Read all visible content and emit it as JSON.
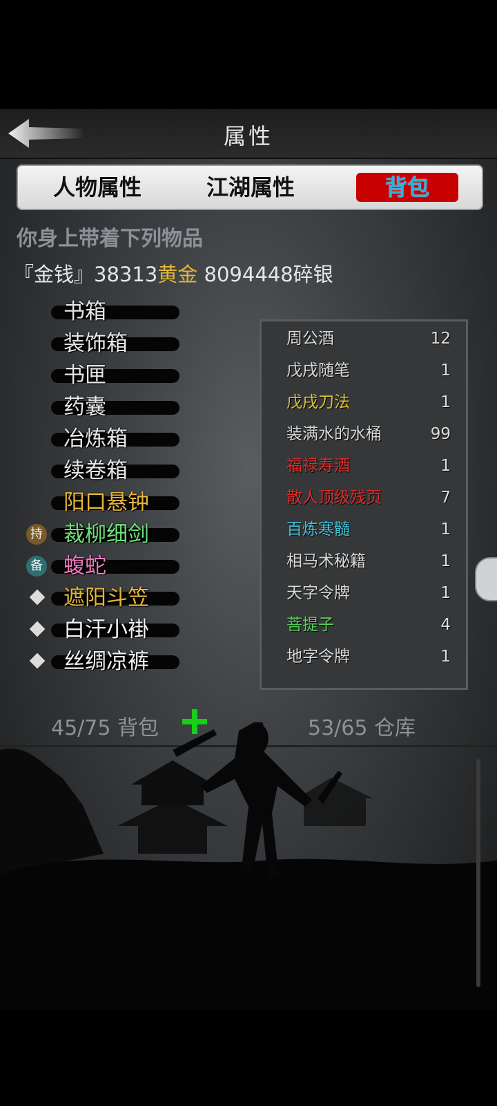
{
  "header": {
    "title": "属性"
  },
  "tabs": [
    {
      "label": "人物属性",
      "active": false
    },
    {
      "label": "江湖属性",
      "active": false
    },
    {
      "label": "背包",
      "active": true
    }
  ],
  "note": "你身上带着下列物品",
  "money": {
    "prefix": "『金钱』",
    "gold_amount": "38313",
    "gold_label": "黄金",
    "silver_amount": "8094448",
    "silver_label": "碎银"
  },
  "left_items": [
    {
      "label": "书箱",
      "color": "#e6e6e6",
      "marker": ""
    },
    {
      "label": "装饰箱",
      "color": "#e6e6e6",
      "marker": ""
    },
    {
      "label": "书匣",
      "color": "#e6e6e6",
      "marker": ""
    },
    {
      "label": "药囊",
      "color": "#e6e6e6",
      "marker": ""
    },
    {
      "label": "冶炼箱",
      "color": "#e6e6e6",
      "marker": ""
    },
    {
      "label": "续卷箱",
      "color": "#e6e6e6",
      "marker": ""
    },
    {
      "label": "阳口悬钟",
      "color": "#e3b53a",
      "marker": ""
    },
    {
      "label": "裁柳细剑",
      "color": "#6ee07a",
      "marker": "持"
    },
    {
      "label": "蝮蛇",
      "color": "#f07bc0",
      "marker": "备"
    },
    {
      "label": "遮阳斗笠",
      "color": "#e3b53a",
      "marker": "diamond"
    },
    {
      "label": "白汗小褂",
      "color": "#f2f2f2",
      "marker": "diamond"
    },
    {
      "label": "丝绸凉裤",
      "color": "#f2f2f2",
      "marker": "diamond"
    }
  ],
  "right_items": [
    {
      "name": "周公酒",
      "qty": "12",
      "color": "#d8d8d8"
    },
    {
      "name": "戊戌随笔",
      "qty": "1",
      "color": "#d8d8d8"
    },
    {
      "name": "戊戌刀法",
      "qty": "1",
      "color": "#d8c23a"
    },
    {
      "name": "装满水的水桶",
      "qty": "99",
      "color": "#d8d8d8"
    },
    {
      "name": "福禄寿酒",
      "qty": "1",
      "color": "#e02a2a"
    },
    {
      "name": "散人顶级残页",
      "qty": "7",
      "color": "#e02a2a"
    },
    {
      "name": "百炼寒髓",
      "qty": "1",
      "color": "#45c2d8"
    },
    {
      "name": "相马术秘籍",
      "qty": "1",
      "color": "#d8d8d8"
    },
    {
      "name": "天字令牌",
      "qty": "1",
      "color": "#d8d8d8"
    },
    {
      "name": "菩提子",
      "qty": "4",
      "color": "#5ccf5c"
    },
    {
      "name": "地字令牌",
      "qty": "1",
      "color": "#d8d8d8"
    }
  ],
  "footer": {
    "bag_text": "45/75 背包",
    "warehouse_text": "53/65 仓库"
  }
}
